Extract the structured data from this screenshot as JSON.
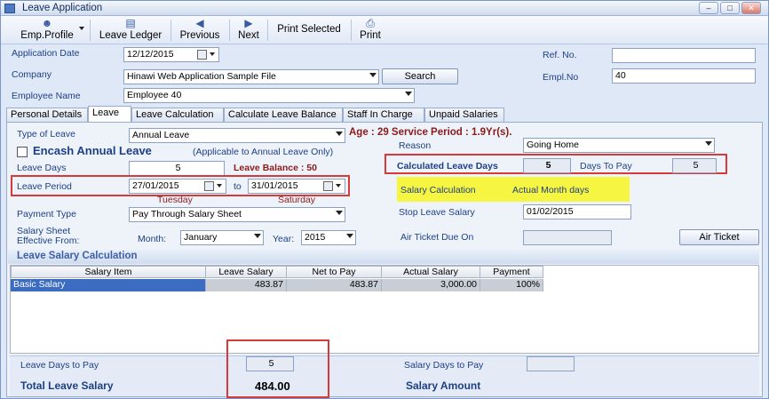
{
  "window": {
    "title": "Leave Application"
  },
  "toolbar": {
    "emp_profile": "Emp.Profile",
    "leave_ledger": "Leave Ledger",
    "previous": "Previous",
    "next": "Next",
    "print_selected": "Print Selected",
    "print": "Print"
  },
  "header": {
    "application_date_label": "Application Date",
    "application_date": "12/12/2015",
    "company_label": "Company",
    "company": "Hinawi Web Application Sample File",
    "search_label": "Search",
    "employee_name_label": "Employee Name",
    "employee_name": "Employee 40",
    "ref_no_label": "Ref. No.",
    "ref_no": "",
    "empl_no_label": "Empl.No",
    "empl_no": "40"
  },
  "tabs": [
    "Personal Details",
    "Leave",
    "Leave Calculation",
    "Calculate Leave Balance",
    "Staff In Charge",
    "Unpaid Salaries"
  ],
  "leave": {
    "type_label": "Type of Leave",
    "type_value": "Annual Leave",
    "age_service": "Age : 29 Service Period : 1.9Yr(s).",
    "encash_label": "Encash Annual Leave",
    "encash_note": "(Applicable to Annual Leave Only)",
    "leave_days_label": "Leave Days",
    "leave_days": "5",
    "leave_balance": "Leave Balance : 50",
    "leave_period_label": "Leave Period",
    "from_date": "27/01/2015",
    "to_label": "to",
    "to_date": "31/01/2015",
    "from_day": "Tuesday",
    "to_day": "Saturday",
    "payment_type_label": "Payment Type",
    "payment_type": "Pay Through Salary Sheet",
    "salary_sheet_label_1": "Salary Sheet",
    "salary_sheet_label_2": "Effective From:",
    "month_label": "Month:",
    "month": "January",
    "year_label": "Year:",
    "year": "2015",
    "reason_label": "Reason",
    "reason": "Going Home",
    "calc_leave_days_label": "Calculated Leave Days",
    "calc_leave_days": "5",
    "days_to_pay_label": "Days To Pay",
    "days_to_pay": "5",
    "salary_calc_label": "Salary Calculation",
    "salary_calc_value": "Actual Month days",
    "stop_leave_salary_label": "Stop Leave Salary",
    "stop_leave_salary": "01/02/2015",
    "air_ticket_due_label": "Air Ticket Due On",
    "air_ticket_due": "",
    "air_ticket_button": "Air Ticket"
  },
  "salary_section": {
    "title": "Leave Salary Calculation",
    "columns": [
      "Salary Item",
      "Leave Salary",
      "Net to Pay",
      "Actual Salary",
      "Payment"
    ],
    "rows": [
      {
        "item": "Basic Salary",
        "leave_salary": "483.87",
        "net_to_pay": "483.87",
        "actual_salary": "3,000.00",
        "payment": "100%"
      }
    ]
  },
  "footer": {
    "leave_days_to_pay_label": "Leave Days to Pay",
    "leave_days_to_pay": "5",
    "salary_days_to_pay_label": "Salary Days to Pay",
    "salary_days_to_pay": "",
    "total_leave_salary_label": "Total Leave Salary",
    "total_leave_salary": "484.00",
    "salary_amount_label": "Salary Amount"
  },
  "colors": {
    "highlight": "#f5f542",
    "annotation": "#d63a3a",
    "label_blue": "#1d3f86"
  }
}
